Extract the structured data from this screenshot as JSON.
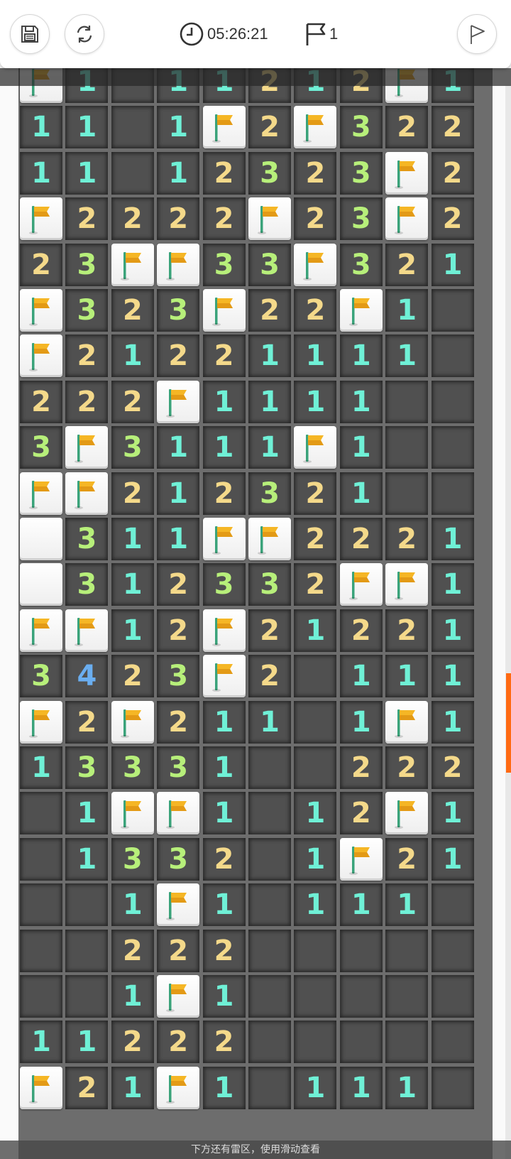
{
  "toolbar": {
    "save_icon": "save-icon",
    "restart_icon": "restart-icon",
    "timer_icon": "clock-icon",
    "timer": "05:26:21",
    "flag_icon": "flag-outline-icon",
    "flags": "1",
    "finish_icon": "finish-flag-icon"
  },
  "hint": "下方还有雷区，使用滑动查看",
  "colors": {
    "n1": "#6ff0d6",
    "n2": "#f4d98a",
    "n3": "#b7ef7a",
    "n4": "#6aaef0",
    "scroll_accent": "#ff6a13"
  },
  "board": {
    "columns": 10,
    "legend": "F = flagged, H = covered (hidden), 0 = revealed empty, digits = revealed number",
    "rows": [
      [
        "F",
        "1",
        "0",
        "1",
        "1",
        "2",
        "1",
        "2",
        "F",
        "1"
      ],
      [
        "1",
        "1",
        "0",
        "1",
        "F",
        "2",
        "F",
        "3",
        "2",
        "2"
      ],
      [
        "1",
        "1",
        "0",
        "1",
        "2",
        "3",
        "2",
        "3",
        "F",
        "2"
      ],
      [
        "F",
        "2",
        "2",
        "2",
        "2",
        "F",
        "2",
        "3",
        "F",
        "2"
      ],
      [
        "2",
        "3",
        "F",
        "F",
        "3",
        "3",
        "F",
        "3",
        "2",
        "1"
      ],
      [
        "F",
        "3",
        "2",
        "3",
        "F",
        "2",
        "2",
        "F",
        "1",
        "0"
      ],
      [
        "F",
        "2",
        "1",
        "2",
        "2",
        "1",
        "1",
        "1",
        "1",
        "0"
      ],
      [
        "2",
        "2",
        "2",
        "F",
        "1",
        "1",
        "1",
        "1",
        "0",
        "0"
      ],
      [
        "3",
        "F",
        "3",
        "1",
        "1",
        "1",
        "F",
        "1",
        "0",
        "0"
      ],
      [
        "F",
        "F",
        "2",
        "1",
        "2",
        "3",
        "2",
        "1",
        "0",
        "0"
      ],
      [
        "H",
        "3",
        "1",
        "1",
        "F",
        "F",
        "2",
        "2",
        "2",
        "1"
      ],
      [
        "H",
        "3",
        "1",
        "2",
        "3",
        "3",
        "2",
        "F",
        "F",
        "1"
      ],
      [
        "F",
        "F",
        "1",
        "2",
        "F",
        "2",
        "1",
        "2",
        "2",
        "1"
      ],
      [
        "3",
        "4",
        "2",
        "3",
        "F",
        "2",
        "0",
        "1",
        "1",
        "1"
      ],
      [
        "F",
        "2",
        "F",
        "2",
        "1",
        "1",
        "0",
        "1",
        "F",
        "1"
      ],
      [
        "1",
        "3",
        "3",
        "3",
        "1",
        "0",
        "0",
        "2",
        "2",
        "2"
      ],
      [
        "0",
        "1",
        "F",
        "F",
        "1",
        "0",
        "1",
        "2",
        "F",
        "1"
      ],
      [
        "0",
        "1",
        "3",
        "3",
        "2",
        "0",
        "1",
        "F",
        "2",
        "1"
      ],
      [
        "0",
        "0",
        "1",
        "F",
        "1",
        "0",
        "1",
        "1",
        "1",
        "0"
      ],
      [
        "0",
        "0",
        "2",
        "2",
        "2",
        "0",
        "0",
        "0",
        "0",
        "0"
      ],
      [
        "0",
        "0",
        "1",
        "F",
        "1",
        "0",
        "0",
        "0",
        "0",
        "0"
      ],
      [
        "1",
        "1",
        "2",
        "2",
        "2",
        "0",
        "0",
        "0",
        "0",
        "0"
      ],
      [
        "F",
        "2",
        "1",
        "F",
        "1",
        "0",
        "1",
        "1",
        "1",
        "0"
      ]
    ]
  }
}
